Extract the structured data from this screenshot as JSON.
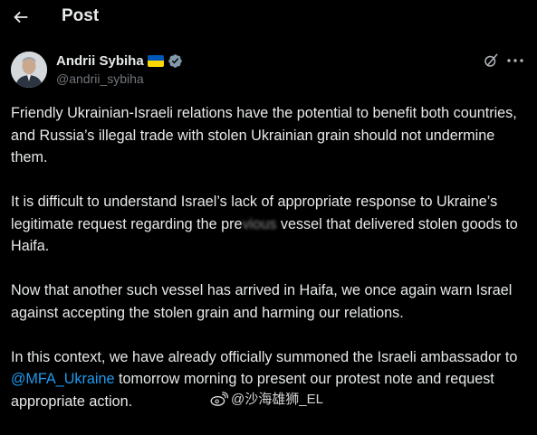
{
  "header": {
    "title": "Post"
  },
  "author": {
    "name": "Andrii Sybiha",
    "handle": "@andrii_sybiha"
  },
  "tweet": {
    "paragraphs": [
      [
        "Friendly Ukrainian-Israeli relations have the potential to benefit both countries, and Russia’s illegal trade with stolen Ukrainian grain should not undermine them."
      ],
      [
        "It is difficult to understand Israel’s lack of appropriate response to Ukraine’s legitimate request regarding the pre",
        "vious",
        " vessel that delivered stolen goods to Haifa."
      ],
      [
        "Now that another such vessel has arrived in Haifa, we once again warn Israel against accepting the stolen grain and harming our relations."
      ],
      [
        "In this context, we have already officially summoned the Israeli ambassador to ",
        "@MFA_Ukraine",
        " tomorrow morning to present our protest note and request appropriate action."
      ]
    ]
  },
  "watermark": {
    "text": "@沙海雄狮_EL"
  },
  "colors": {
    "background": "#000000",
    "text": "#e7e9ea",
    "secondary": "#71767b",
    "accent": "#1d9bf0"
  }
}
